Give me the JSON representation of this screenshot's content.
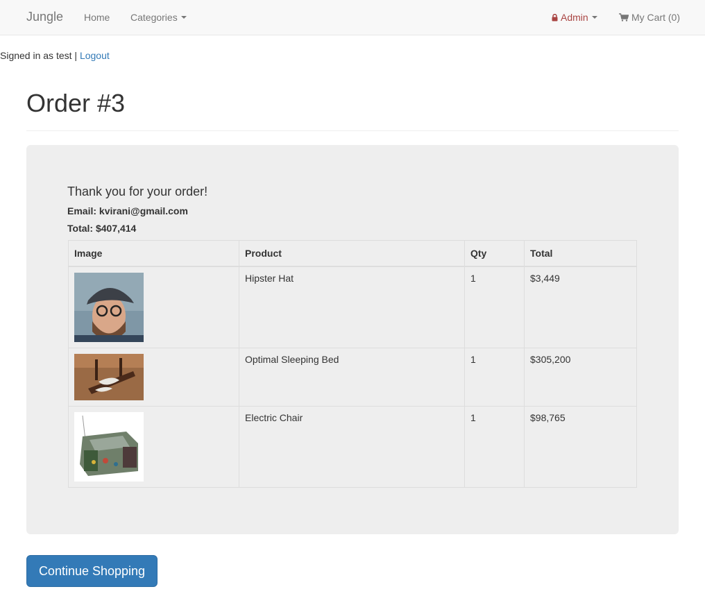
{
  "navbar": {
    "brand": "Jungle",
    "home": "Home",
    "categories": "Categories",
    "admin": "Admin",
    "cart": "My Cart (0)"
  },
  "session": {
    "signed_in": "Signed in as test |",
    "logout": "Logout"
  },
  "page": {
    "title": "Order #3"
  },
  "order": {
    "thanks": "Thank you for your order!",
    "email": "Email: kvirani@gmail.com",
    "total": "Total: $407,414",
    "columns": [
      "Image",
      "Product",
      "Qty",
      "Total"
    ],
    "rows": [
      {
        "product": "Hipster Hat",
        "qty": "1",
        "total": "$3,449"
      },
      {
        "product": "Optimal Sleeping Bed",
        "qty": "1",
        "total": "$305,200"
      },
      {
        "product": "Electric Chair",
        "qty": "1",
        "total": "$98,765"
      }
    ]
  },
  "actions": {
    "continue": "Continue Shopping"
  },
  "colors": {
    "link": "#337ab7",
    "admin": "#a94442",
    "panel": "#eeeeee",
    "button": "#337ab7"
  }
}
